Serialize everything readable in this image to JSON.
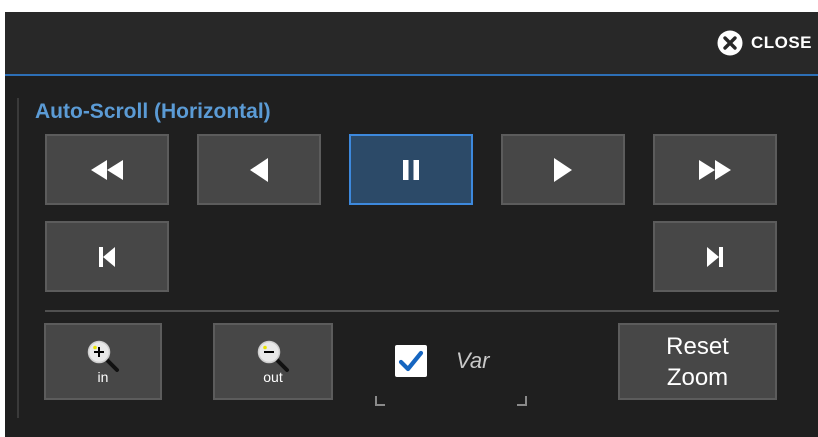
{
  "titlebar": {
    "close_label": "CLOSE"
  },
  "section": {
    "title": "Auto-Scroll (Horizontal)"
  },
  "transport": [
    {
      "name": "fast-rewind",
      "icon": "fast-rewind-icon"
    },
    {
      "name": "step-back",
      "icon": "play-left-icon"
    },
    {
      "name": "pause",
      "icon": "pause-icon",
      "active": true
    },
    {
      "name": "play",
      "icon": "play-right-icon"
    },
    {
      "name": "fast-forward",
      "icon": "fast-forward-icon"
    },
    {
      "name": "skip-to-start",
      "icon": "skip-start-icon"
    },
    {
      "name": "skip-to-end",
      "icon": "skip-end-icon"
    }
  ],
  "zoom": {
    "in_label": "in",
    "out_label": "out",
    "var_label": "Var",
    "var_checked": true,
    "reset_line1": "Reset",
    "reset_line2": "Zoom"
  },
  "colors": {
    "accent": "#3d89dd",
    "title_blue": "#5b9bd5",
    "panel": "#1f1f1f",
    "button": "#474747",
    "active_button": "#2c4a68"
  }
}
